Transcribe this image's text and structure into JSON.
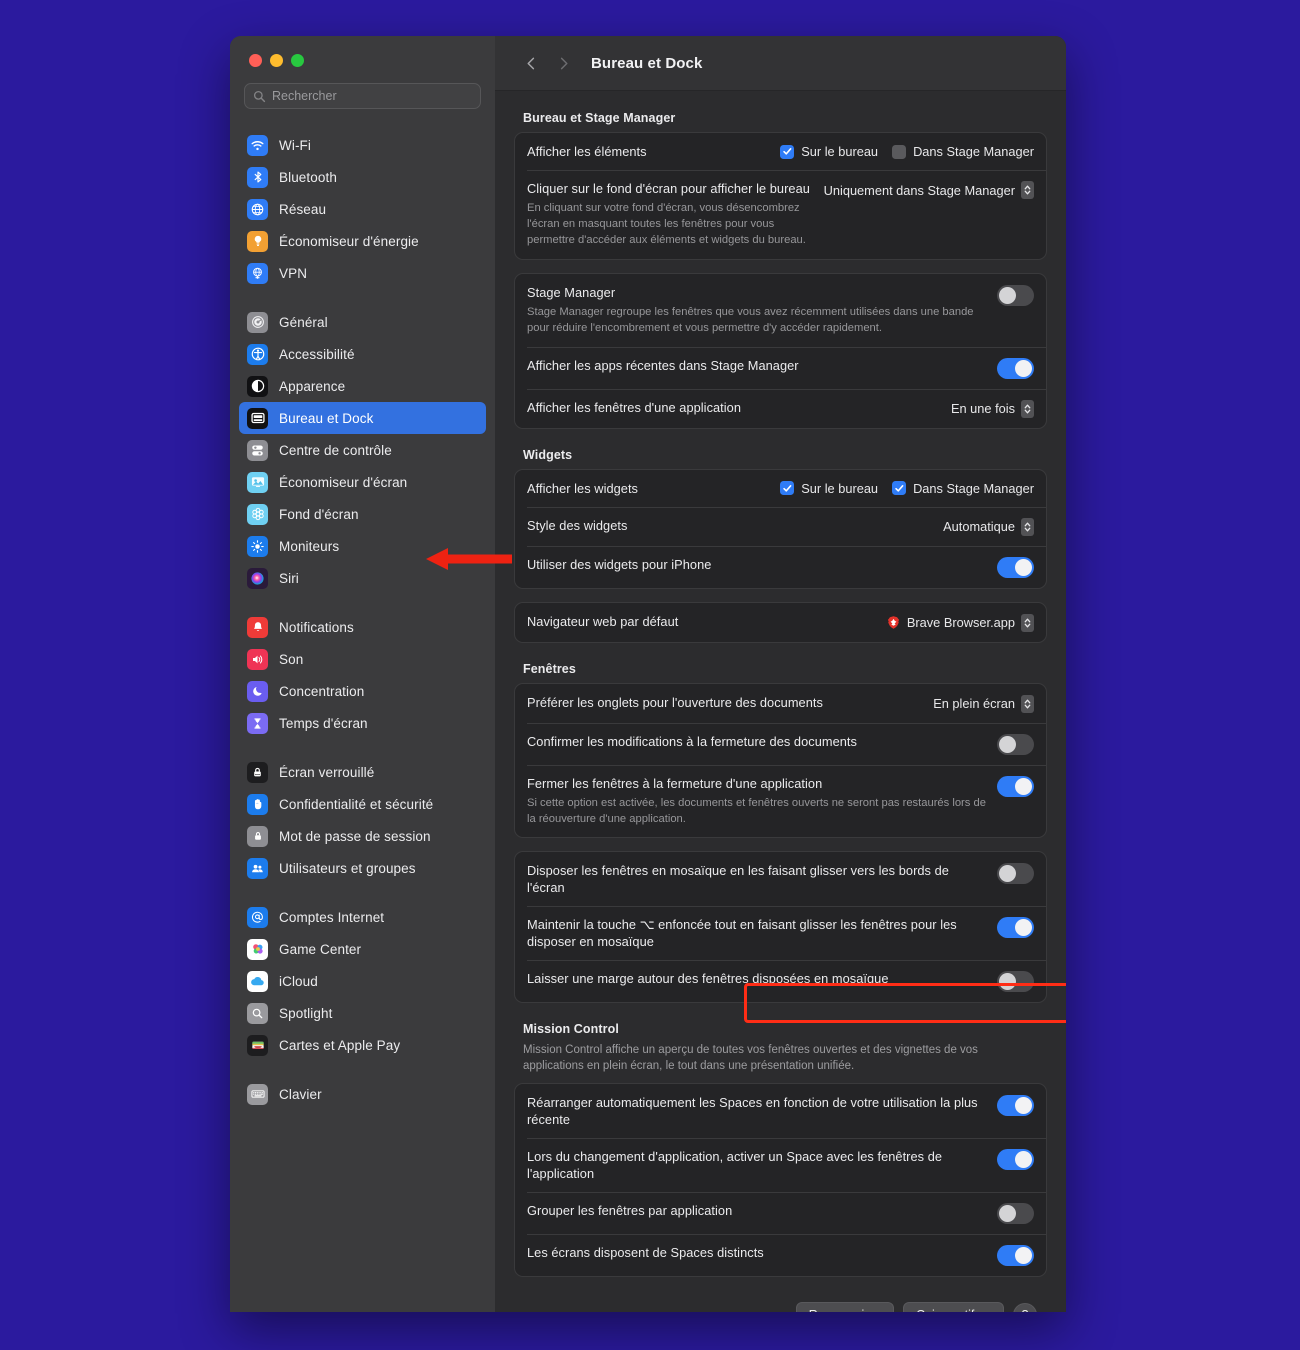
{
  "window": {
    "traffic_lights": [
      "close",
      "minimize",
      "zoom"
    ],
    "search": {
      "placeholder": "Rechercher",
      "value": "",
      "icon": "search-icon"
    }
  },
  "titlebar": {
    "back_icon": "chevron-left-icon",
    "forward_icon": "chevron-right-icon",
    "title": "Bureau et Dock"
  },
  "sidebar": {
    "groups": [
      {
        "items": [
          {
            "label": "Wi-Fi",
            "icon": "wifi-icon",
            "color": "#2f7cf6",
            "selected": false
          },
          {
            "label": "Bluetooth",
            "icon": "bluetooth-icon",
            "color": "#2f7cf6",
            "selected": false
          },
          {
            "label": "Réseau",
            "icon": "globe-icon",
            "color": "#2f7cf6",
            "selected": false
          },
          {
            "label": "Économiseur d'énergie",
            "icon": "lightbulb-icon",
            "color": "#f2a033",
            "selected": false
          },
          {
            "label": "VPN",
            "icon": "vpn-globe-icon",
            "color": "#2f7cf6",
            "selected": false
          }
        ]
      },
      {
        "items": [
          {
            "label": "Général",
            "icon": "gear-icon",
            "color": "#8e8e93",
            "selected": false
          },
          {
            "label": "Accessibilité",
            "icon": "accessibility-icon",
            "color": "#1c7ced",
            "selected": false
          },
          {
            "label": "Apparence",
            "icon": "appearance-icon",
            "color": "#111113",
            "selected": false
          },
          {
            "label": "Bureau et Dock",
            "icon": "desktop-dock-icon",
            "color": "#111113",
            "selected": true
          },
          {
            "label": "Centre de contrôle",
            "icon": "control-center-icon",
            "color": "#8e8e93",
            "selected": false
          },
          {
            "label": "Économiseur d'écran",
            "icon": "screensaver-icon",
            "color": "#6fd0f2",
            "selected": false
          },
          {
            "label": "Fond d'écran",
            "icon": "wallpaper-icon",
            "color": "#6fd0f2",
            "selected": false
          },
          {
            "label": "Moniteurs",
            "icon": "display-icon",
            "color": "#1c7ced",
            "selected": false
          },
          {
            "label": "Siri",
            "icon": "siri-icon",
            "color": "#2a1a3a",
            "selected": false
          }
        ]
      },
      {
        "items": [
          {
            "label": "Notifications",
            "icon": "bell-icon",
            "color": "#ef3b38",
            "selected": false
          },
          {
            "label": "Son",
            "icon": "speaker-icon",
            "color": "#ef3455",
            "selected": false
          },
          {
            "label": "Concentration",
            "icon": "moon-icon",
            "color": "#6a5df0",
            "selected": false
          },
          {
            "label": "Temps d'écran",
            "icon": "hourglass-icon",
            "color": "#7b6bf3",
            "selected": false
          }
        ]
      },
      {
        "items": [
          {
            "label": "Écran verrouillé",
            "icon": "lock-screen-icon",
            "color": "#1d1d1f",
            "selected": false
          },
          {
            "label": "Confidentialité et sécurité",
            "icon": "hand-raised-icon",
            "color": "#1c7ced",
            "selected": false
          },
          {
            "label": "Mot de passe de session",
            "icon": "padlock-icon",
            "color": "#8e8e93",
            "selected": false
          },
          {
            "label": "Utilisateurs et groupes",
            "icon": "users-icon",
            "color": "#1c7ced",
            "selected": false
          }
        ]
      },
      {
        "items": [
          {
            "label": "Comptes Internet",
            "icon": "at-sign-icon",
            "color": "#1c7ced",
            "selected": false
          },
          {
            "label": "Game Center",
            "icon": "game-center-icon",
            "color": "#ffffff",
            "selected": false
          },
          {
            "label": "iCloud",
            "icon": "icloud-icon",
            "color": "#ffffff",
            "selected": false
          },
          {
            "label": "Spotlight",
            "icon": "spotlight-search-icon",
            "color": "#9a9a9e",
            "selected": false
          },
          {
            "label": "Cartes et Apple Pay",
            "icon": "wallet-icon",
            "color": "#1d1d1f",
            "selected": false
          }
        ]
      },
      {
        "items": [
          {
            "label": "Clavier",
            "icon": "keyboard-icon",
            "color": "#9a9a9e",
            "selected": false
          }
        ]
      }
    ]
  },
  "sections": [
    {
      "heading": "Bureau et Stage Manager",
      "rows": [
        {
          "label": "Afficher les éléments",
          "control": "checkboxes",
          "checkboxes": [
            {
              "label": "Sur le bureau",
              "checked": true
            },
            {
              "label": "Dans Stage Manager",
              "checked": false
            }
          ]
        },
        {
          "label": "Cliquer sur le fond d'écran pour afficher le bureau",
          "sub": "En cliquant sur votre fond d'écran, vous désencombrez l'écran en masquant toutes les fenêtres pour vous permettre d'accéder aux éléments et widgets du bureau.",
          "control": "popup",
          "value": "Uniquement dans Stage Manager"
        }
      ]
    },
    {
      "heading": "",
      "rows": [
        {
          "label": "Stage Manager",
          "sub": "Stage Manager regroupe les fenêtres que vous avez récemment utilisées dans une bande pour réduire l'encombrement et vous permettre d'y accéder rapidement.",
          "control": "toggle",
          "on": false
        },
        {
          "label": "Afficher les apps récentes dans Stage Manager",
          "control": "toggle",
          "on": true
        },
        {
          "label": "Afficher les fenêtres d'une application",
          "control": "popup",
          "value": "En une fois"
        }
      ]
    },
    {
      "heading": "Widgets",
      "rows": [
        {
          "label": "Afficher les widgets",
          "control": "checkboxes",
          "checkboxes": [
            {
              "label": "Sur le bureau",
              "checked": true
            },
            {
              "label": "Dans Stage Manager",
              "checked": true
            }
          ]
        },
        {
          "label": "Style des widgets",
          "control": "popup",
          "value": "Automatique"
        },
        {
          "label": "Utiliser des widgets pour iPhone",
          "control": "toggle",
          "on": true
        }
      ]
    },
    {
      "heading": "",
      "rows": [
        {
          "label": "Navigateur web par défaut",
          "control": "popup-icon",
          "value": "Brave Browser.app",
          "icon": "brave-browser-icon"
        }
      ]
    },
    {
      "heading": "Fenêtres",
      "rows": [
        {
          "label": "Préférer les onglets pour l'ouverture des documents",
          "control": "popup",
          "value": "En plein écran"
        },
        {
          "label": "Confirmer les modifications à la fermeture des documents",
          "control": "toggle",
          "on": false
        },
        {
          "label": "Fermer les fenêtres à la fermeture d'une application",
          "sub": "Si cette option est activée, les documents et fenêtres ouverts ne seront pas restaurés lors de la réouverture d'une application.",
          "control": "toggle",
          "on": true
        }
      ]
    },
    {
      "heading": "",
      "rows": [
        {
          "label": "Disposer les fenêtres en mosaïque en les faisant glisser vers les bords de l'écran",
          "control": "toggle",
          "on": false
        },
        {
          "label": "Maintenir la touche ⌥ enfoncée tout en faisant glisser les fenêtres pour les disposer en mosaïque",
          "control": "toggle",
          "on": true
        },
        {
          "label": "Laisser une marge autour des fenêtres disposées en mosaïque",
          "control": "toggle",
          "on": false,
          "highlighted": true
        }
      ]
    },
    {
      "heading": "Mission Control",
      "description": "Mission Control affiche un aperçu de toutes vos fenêtres ouvertes et des vignettes de vos applications en plein écran, le tout dans une présentation unifiée.",
      "rows": [
        {
          "label": "Réarranger automatiquement les Spaces en fonction de votre utilisation la plus récente",
          "control": "toggle",
          "on": true
        },
        {
          "label": "Lors du changement d'application, activer un Space avec les fenêtres de l'application",
          "control": "toggle",
          "on": true
        },
        {
          "label": "Grouper les fenêtres par application",
          "control": "toggle",
          "on": false
        },
        {
          "label": "Les écrans disposent de Spaces distincts",
          "control": "toggle",
          "on": true
        }
      ]
    }
  ],
  "footer": {
    "shortcuts_label": "Raccourcis...",
    "hot_corners_label": "Coins actifs...",
    "help_label": "?"
  },
  "annotations": {
    "arrow_color": "#ee2212",
    "highlight_color": "#ff2d16",
    "arrow_target": "Bureau et Dock",
    "highlight_target": "Laisser une marge autour des fenêtres disposées en mosaïque"
  },
  "colors": {
    "desktop_background": "#2b1a9e",
    "accent": "#2f7cf6",
    "selection": "#3371e0"
  }
}
